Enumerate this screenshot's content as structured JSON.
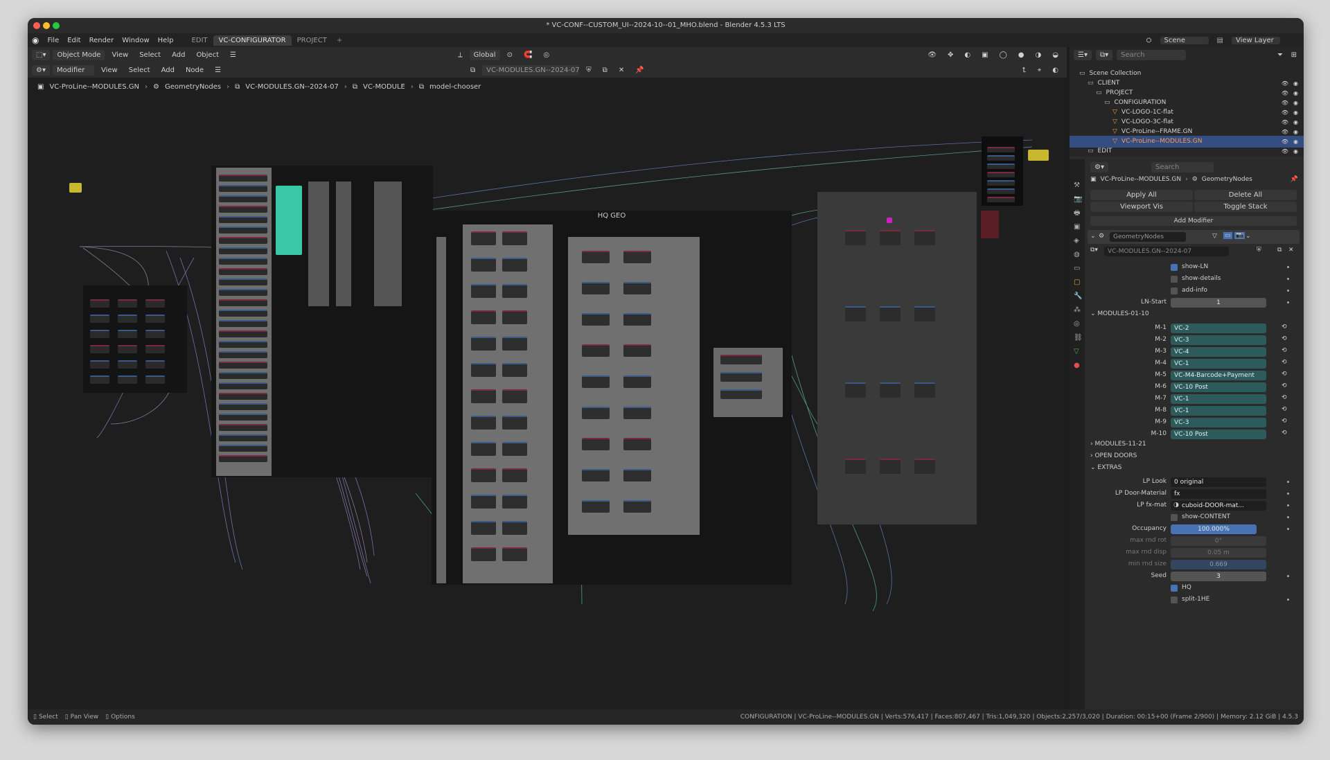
{
  "window_title": "* VC-CONF--CUSTOM_UI--2024-10--01_MHO.blend - Blender 4.5.3 LTS",
  "menu": {
    "items": [
      "File",
      "Edit",
      "Render",
      "Window",
      "Help"
    ]
  },
  "workspaces": {
    "tabs": [
      "EDIT",
      "VC-CONFIGURATOR",
      "PROJECT"
    ],
    "active": "VC-CONFIGURATOR",
    "add": "+"
  },
  "header": {
    "scene_label": "Scene",
    "view_layer_label": "View Layer",
    "mode": "Object Mode",
    "menus": [
      "View",
      "Select",
      "Add",
      "Object"
    ],
    "transform": "Global"
  },
  "node_header": {
    "editor_type": "Modifier",
    "menus": [
      "View",
      "Select",
      "Add",
      "Node"
    ],
    "node_group": "VC-MODULES.GN--2024-07"
  },
  "breadcrumb": [
    "VC-ProLine--MODULES.GN",
    "GeometryNodes",
    "VC-MODULES.GN--2024-07",
    "VC-MODULE",
    "model-chooser"
  ],
  "canvas": {
    "frame_label": "HQ GEO"
  },
  "outliner": {
    "search_placeholder": "Search",
    "rows": [
      {
        "label": "Scene Collection",
        "indent": 0
      },
      {
        "label": "CLIENT",
        "indent": 1
      },
      {
        "label": "PROJECT",
        "indent": 2
      },
      {
        "label": "CONFIGURATION",
        "indent": 3
      },
      {
        "label": "VC-LOGO-1C-flat",
        "indent": 4
      },
      {
        "label": "VC-LOGO-3C-flat",
        "indent": 4
      },
      {
        "label": "VC-ProLine--FRAME.GN",
        "indent": 4
      },
      {
        "label": "VC-ProLine--MODULES.GN",
        "indent": 4,
        "selected": true
      },
      {
        "label": "EDIT",
        "indent": 1
      }
    ]
  },
  "properties": {
    "search_placeholder": "Search",
    "object_name": "VC-ProLine--MODULES.GN",
    "modifier_path": "GeometryNodes",
    "apply_all": "Apply All",
    "delete_all": "Delete All",
    "viewport_vis": "Viewport Vis",
    "toggle_stack": "Toggle Stack",
    "add_modifier": "Add Modifier",
    "modifier_name": "GeometryNodes",
    "node_group": "VC-MODULES.GN--2024-07",
    "checkboxes": [
      {
        "label": "show-LN",
        "on": true
      },
      {
        "label": "show-details",
        "on": false
      },
      {
        "label": "add-info",
        "on": false
      }
    ],
    "ln_start_label": "LN-Start",
    "ln_start_value": "1",
    "modules_section": "MODULES-01-10",
    "modules": [
      {
        "label": "M-1",
        "value": "VC-2"
      },
      {
        "label": "M-2",
        "value": "VC-3"
      },
      {
        "label": "M-3",
        "value": "VC-4"
      },
      {
        "label": "M-4",
        "value": "VC-1"
      },
      {
        "label": "M-5",
        "value": "VC-M4-Barcode+Payment"
      },
      {
        "label": "M-6",
        "value": "VC-10 Post"
      },
      {
        "label": "M-7",
        "value": "VC-1"
      },
      {
        "label": "M-8",
        "value": "VC-1"
      },
      {
        "label": "M-9",
        "value": "VC-3"
      },
      {
        "label": "M-10",
        "value": "VC-10 Post"
      }
    ],
    "collapsed_sections": [
      "MODULES-11-21",
      "OPEN DOORS"
    ],
    "extras_section": "EXTRAS",
    "lp_look_label": "LP Look",
    "lp_look_value": "0 original",
    "lp_door_label": "LP Door-Material",
    "lp_door_value": "fx",
    "lp_fx_label": "LP fx-mat",
    "lp_fx_value": "cuboid-DOOR-mat...",
    "show_content": "show-CONTENT",
    "occupancy_label": "Occupancy",
    "occupancy_value": "100.000%",
    "max_rnd_rot_label": "max rnd rot",
    "max_rnd_rot_value": "0°",
    "max_rnd_disp_label": "max rnd disp",
    "max_rnd_disp_value": "0.05 m",
    "min_rnd_size_label": "min rnd size",
    "min_rnd_size_value": "0.669",
    "seed_label": "Seed",
    "seed_value": "3",
    "hq_label": "HQ",
    "split_label": "split-1HE"
  },
  "statusbar": {
    "select": "Select",
    "pan": "Pan View",
    "options": "Options",
    "info": "CONFIGURATION | VC-ProLine--MODULES.GN | Verts:576,417 | Faces:807,467 | Tris:1,049,320 | Objects:2,257/3,020 | Duration: 00:15+00 (Frame 2/900) | Memory: 2.12 GiB | 4.5.3"
  },
  "colors": {
    "accent_blue": "#4772b3",
    "teal_field": "#2d5a5a",
    "selected_row": "#334d80"
  }
}
